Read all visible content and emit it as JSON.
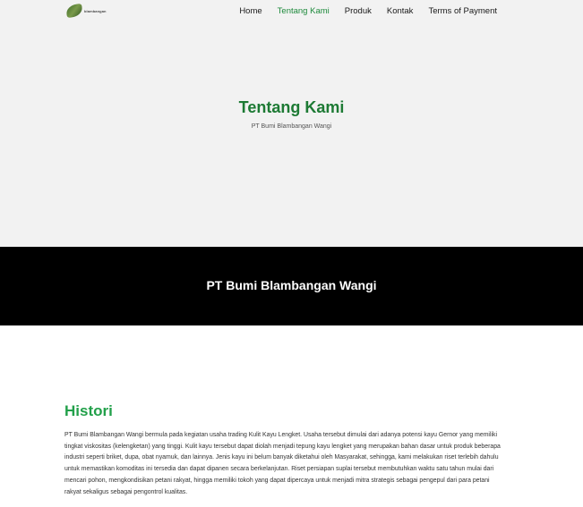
{
  "header": {
    "logo_icon": "leaf-logo-icon",
    "logo_text": "blambangan",
    "nav": [
      {
        "label": "Home",
        "active": false
      },
      {
        "label": "Tentang Kami",
        "active": true
      },
      {
        "label": "Produk",
        "active": false
      },
      {
        "label": "Kontak",
        "active": false
      },
      {
        "label": "Terms of Payment",
        "active": false
      }
    ]
  },
  "hero": {
    "title": "Tentang Kami",
    "subtitle": "PT Bumi Blambangan Wangi"
  },
  "band": {
    "title": "PT Bumi Blambangan Wangi"
  },
  "histori": {
    "title": "Histori",
    "body": "PT Bumi Blambangan Wangi bermula pada kegiatan usaha trading Kulit Kayu Lengket. Usaha tersebut dimulai dari adanya potensi kayu Gernor yang memiliki tingkat viskositas (kelengketan) yang tinggi. Kulit kayu tersebut dapat diolah menjadi tepung kayu lengket yang merupakan bahan dasar untuk produk beberapa industri seperti briket, dupa, obat nyamuk, dan lainnya. Jenis kayu ini belum banyak diketahui oleh Masyarakat, sehingga, kami melakukan riset terlebih dahulu untuk memastikan komoditas ini tersedia dan dapat dipanen secara berkelanjutan. Riset persiapan suplai tersebut membutuhkan waktu satu tahun mulai dari mencari pohon, mengkondisikan petani rakyat, hingga memiliki tokoh yang dapat dipercaya untuk menjadi mitra strategis sebagai pengepul dari para petani rakyat sekaligus sebagai pengontrol kualitas."
  },
  "colors": {
    "accent": "#1e8a3c",
    "hero_bg": "#f2f2f2",
    "band_bg": "#000000",
    "histori_title": "#22a04a"
  }
}
